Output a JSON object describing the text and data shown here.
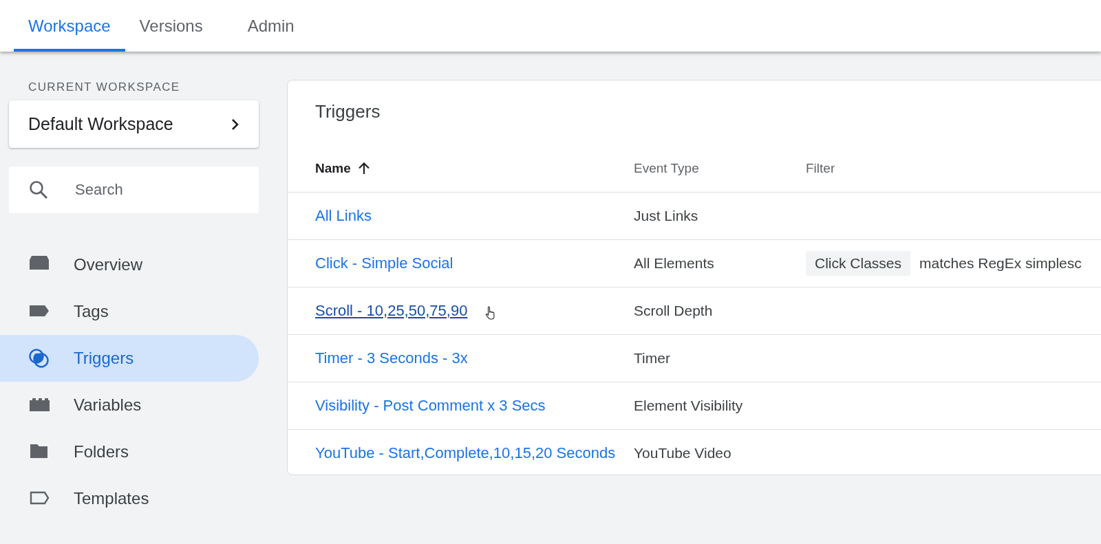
{
  "tabs": [
    {
      "label": "Workspace",
      "selected": true
    },
    {
      "label": "Versions",
      "selected": false
    },
    {
      "label": "Admin",
      "selected": false
    }
  ],
  "sidebar": {
    "workspace_label": "CURRENT WORKSPACE",
    "workspace": "Default Workspace",
    "search": {
      "placeholder": "Search"
    },
    "items": [
      {
        "label": "Overview",
        "kind": "overview",
        "selected": false
      },
      {
        "label": "Tags",
        "kind": "tag",
        "selected": false
      },
      {
        "label": "Triggers",
        "kind": "trigger",
        "selected": true
      },
      {
        "label": "Variables",
        "kind": "variable",
        "selected": false
      },
      {
        "label": "Folders",
        "kind": "folder",
        "selected": false
      },
      {
        "label": "Templates",
        "kind": "template",
        "selected": false
      }
    ]
  },
  "table": {
    "title": "Triggers",
    "columns": [
      {
        "label": "Name",
        "sorted": true
      },
      {
        "label": "Event Type",
        "sorted": false
      },
      {
        "label": "Filter",
        "sorted": false
      }
    ],
    "rows": [
      {
        "name": "All Links",
        "event_type": "Just Links",
        "hovered": false
      },
      {
        "name": "Click - Simple Social",
        "event_type": "All Elements",
        "filter": {
          "variable": "Click Classes",
          "condition": "matches RegEx simplesc"
        },
        "hovered": false
      },
      {
        "name": "Scroll - 10,25,50,75,90",
        "event_type": "Scroll Depth",
        "hovered": true
      },
      {
        "name": "Timer - 3 Seconds - 3x",
        "event_type": "Timer",
        "hovered": false
      },
      {
        "name": "Visibility - Post Comment x 3 Secs",
        "event_type": "Element Visibility",
        "hovered": false
      },
      {
        "name": "YouTube - Start,Complete,10,15,20 Seconds",
        "event_type": "YouTube Video",
        "hovered": false
      }
    ]
  }
}
